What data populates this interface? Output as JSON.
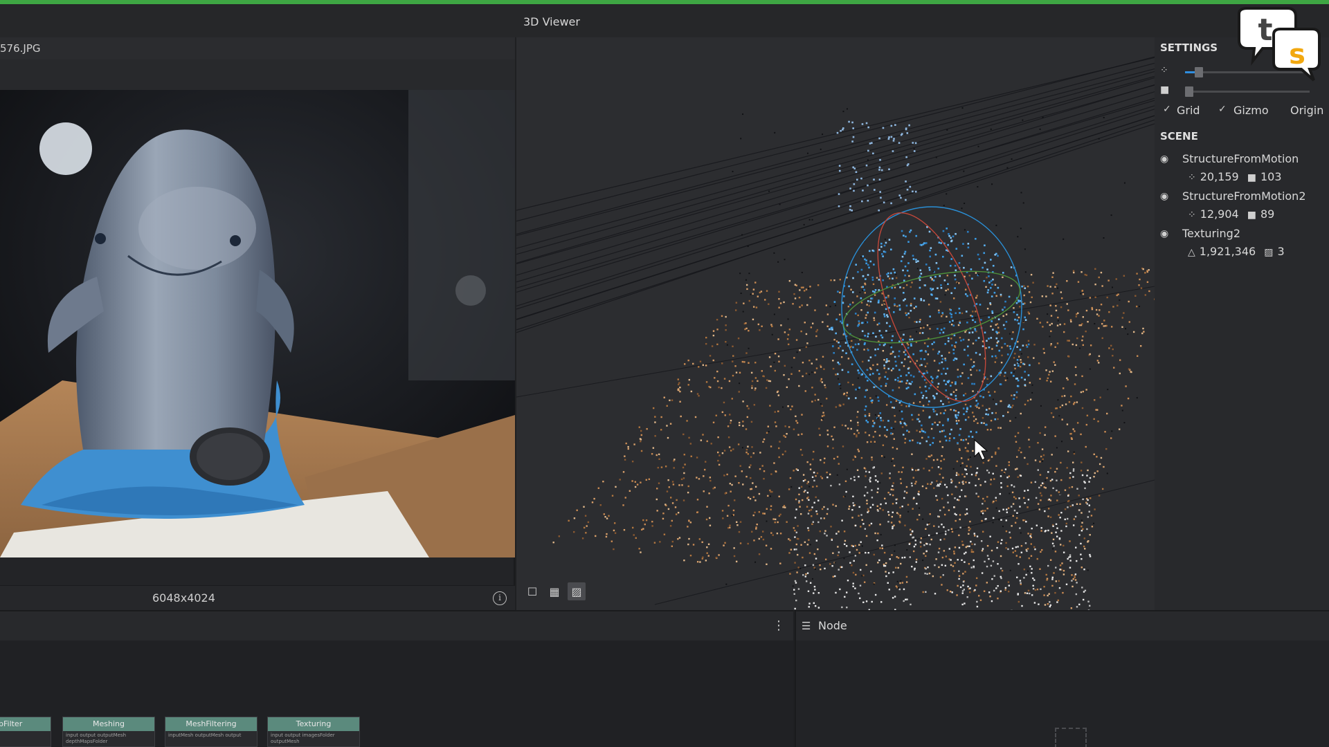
{
  "image_viewer": {
    "filename": "576.JPG",
    "resolution": "6048x4024",
    "info_icon": "info-circle-icon"
  },
  "viewer3d": {
    "title": "3D Viewer",
    "tools": [
      {
        "name": "single-view-icon",
        "glyph": "☐"
      },
      {
        "name": "grid-view-icon",
        "glyph": "▦"
      },
      {
        "name": "wireframe-view-icon",
        "glyph": "▨"
      }
    ]
  },
  "settings": {
    "title": "SETTINGS",
    "point_size_slider": {
      "icon": "points-icon",
      "glyph": "⁘",
      "value": 0.08
    },
    "camera_scale_slider": {
      "icon": "camera-icon",
      "glyph": "■",
      "value": 0.0
    },
    "grid": {
      "label": "Grid",
      "checked": true
    },
    "gizmo": {
      "label": "Gizmo",
      "checked": true
    },
    "origin": {
      "label": "Origin",
      "checked": false
    }
  },
  "scene": {
    "title": "SCENE",
    "items": [
      {
        "name": "StructureFromMotion",
        "stat1_icon": "⁘",
        "stat1": "20,159",
        "stat2_icon": "■",
        "stat2": "103"
      },
      {
        "name": "StructureFromMotion2",
        "stat1_icon": "⁘",
        "stat1": "12,904",
        "stat2_icon": "■",
        "stat2": "89"
      },
      {
        "name": "Texturing2",
        "stat1_icon": "△",
        "stat1": "1,921,346",
        "stat2_icon": "▨",
        "stat2": "3"
      }
    ]
  },
  "graph": {
    "nodes": [
      {
        "title": "MapFilter",
        "ports": "output"
      },
      {
        "title": "Meshing",
        "ports": "input  output  outputMesh  depthMapsFolder"
      },
      {
        "title": "MeshFiltering",
        "ports": "inputMesh  outputMesh  output"
      },
      {
        "title": "Texturing",
        "ports": "input  output  imagesFolder  outputMesh"
      }
    ]
  },
  "node_panel": {
    "title": "Node"
  },
  "colors": {
    "accent_green": "#3ea643",
    "node_header": "#5b8a7d",
    "slider_blue": "#2f8ee0"
  }
}
